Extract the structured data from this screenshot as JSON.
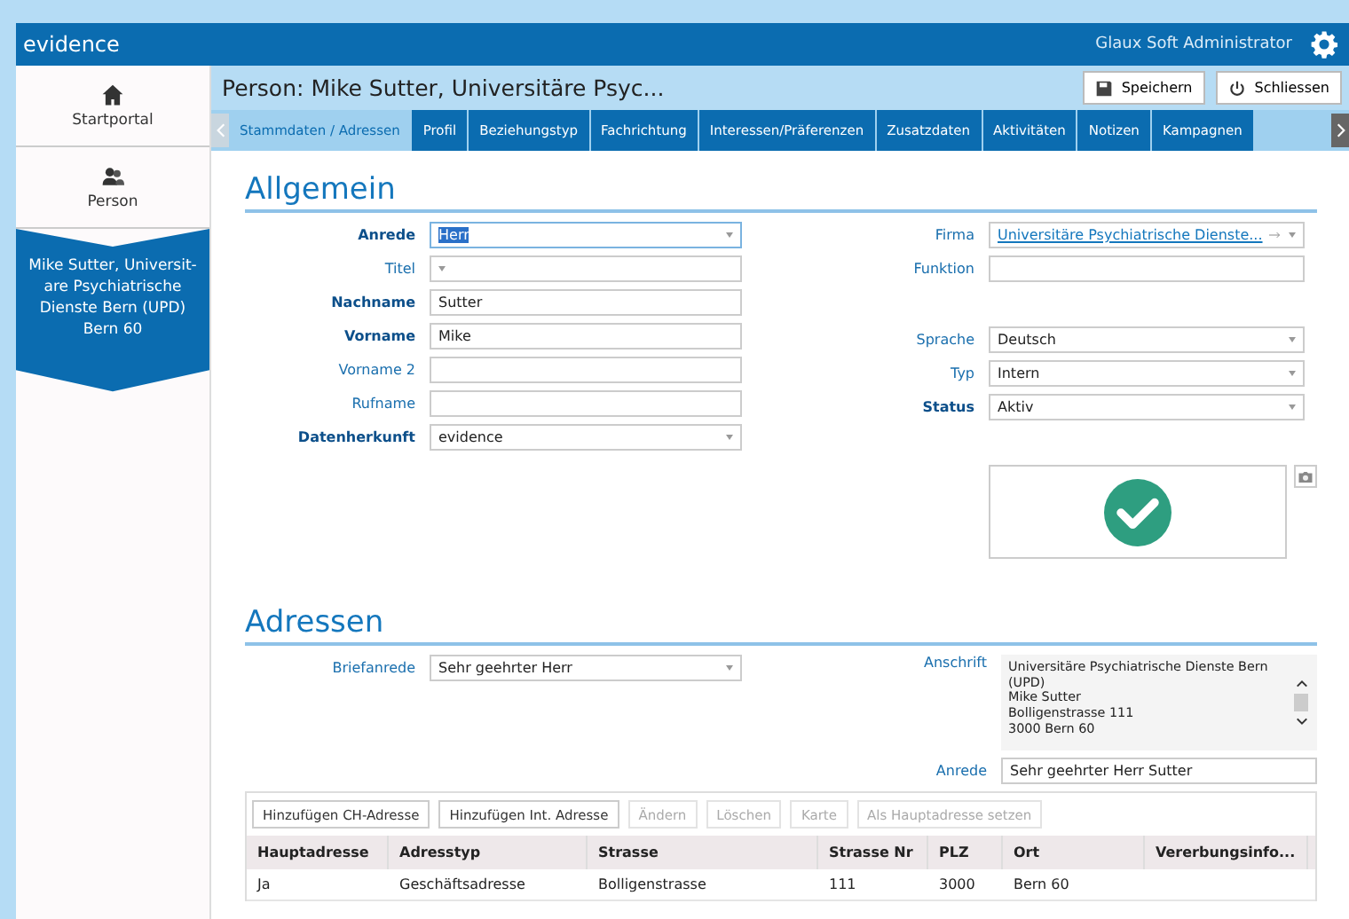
{
  "app": {
    "logo": "evidence",
    "user": "Glaux Soft Administrator"
  },
  "sidebar": {
    "items": [
      {
        "label": "Startportal",
        "selected": false
      },
      {
        "label": "Person",
        "selected": false
      },
      {
        "label": "Mike Sutter, Universit-are Psychiatrische Dienste Bern (UPD) Bern 60",
        "selected": true
      }
    ]
  },
  "page": {
    "title": "Person: Mike Sutter, Universitäre Psyc...",
    "buttons": [
      {
        "label": "Speichern"
      },
      {
        "label": "Schliessen"
      }
    ]
  },
  "tabs": [
    {
      "label": "Stammdaten / Adressen",
      "selected": true
    },
    {
      "label": "Profil",
      "selected": false
    },
    {
      "label": "Beziehungstyp",
      "selected": false
    },
    {
      "label": "Fachrichtung",
      "selected": false
    },
    {
      "label": "Interessen/Präferenzen",
      "selected": false
    },
    {
      "label": "Zusatzdaten",
      "selected": false
    },
    {
      "label": "Aktivitäten",
      "selected": false
    },
    {
      "label": "Notizen",
      "selected": false
    },
    {
      "label": "Kampagnen",
      "selected": false
    }
  ],
  "allgemein": {
    "heading": "Allgemein",
    "left": [
      {
        "label": "Anrede",
        "bold": true,
        "kind": "select",
        "value": "Herr",
        "focused": true
      },
      {
        "label": "Titel",
        "bold": false,
        "kind": "select",
        "focused": false
      },
      {
        "label": "Nachname",
        "bold": true,
        "kind": "text",
        "value": "Sutter",
        "focused": false
      },
      {
        "label": "Vorname",
        "bold": true,
        "kind": "text",
        "value": "Mike",
        "focused": false
      },
      {
        "label": "Vorname 2",
        "bold": false,
        "kind": "text",
        "focused": false
      },
      {
        "label": "Rufname",
        "bold": false,
        "kind": "text",
        "focused": false
      },
      {
        "label": "Datenherkunft",
        "bold": true,
        "kind": "select",
        "value": "evidence",
        "focused": false
      }
    ],
    "right_groups": [
      [
        {
          "label": "Firma",
          "bold": false,
          "kind": "link",
          "value": "Universitäre Psychiatrische Dienste..."
        },
        {
          "label": "Funktion",
          "bold": false,
          "kind": "text"
        }
      ],
      [
        {
          "label": "Sprache",
          "bold": false,
          "kind": "select",
          "value": "Deutsch"
        },
        {
          "label": "Typ",
          "bold": false,
          "kind": "select",
          "value": "Intern"
        },
        {
          "label": "Status",
          "bold": true,
          "kind": "select",
          "value": "Aktiv"
        }
      ]
    ]
  },
  "adressen": {
    "heading": "Adressen",
    "briefanrede": {
      "label": "Briefanrede",
      "value": "Sehr geehrter Herr"
    },
    "anschrift": {
      "label": "Anschrift",
      "lines": [
        "Universitäre Psychiatrische Dienste Bern",
        "(UPD)",
        "Mike Sutter",
        "Bolligenstrasse 111",
        "3000 Bern 60"
      ]
    },
    "anrede": {
      "label": "Anrede",
      "value": "Sehr geehrter Herr Sutter"
    },
    "buttons": [
      {
        "label": "Hinzufügen CH-Adresse",
        "disabled": false
      },
      {
        "label": "Hinzufügen Int. Adresse",
        "disabled": false
      },
      {
        "label": "Ändern",
        "disabled": true
      },
      {
        "label": "Löschen",
        "disabled": true
      },
      {
        "label": "Karte",
        "disabled": true
      },
      {
        "label": "Als Hauptadresse setzen",
        "disabled": true
      }
    ],
    "table": {
      "columns": [
        "Hauptadresse",
        "Adresstyp",
        "Strasse",
        "Strasse Nr",
        "PLZ",
        "Ort",
        "Vererbungsinfo..."
      ],
      "rows": [
        [
          "Ja",
          "Geschäftsadresse",
          "Bolligenstrasse",
          "111",
          "3000",
          "Bern 60",
          ""
        ]
      ]
    }
  }
}
